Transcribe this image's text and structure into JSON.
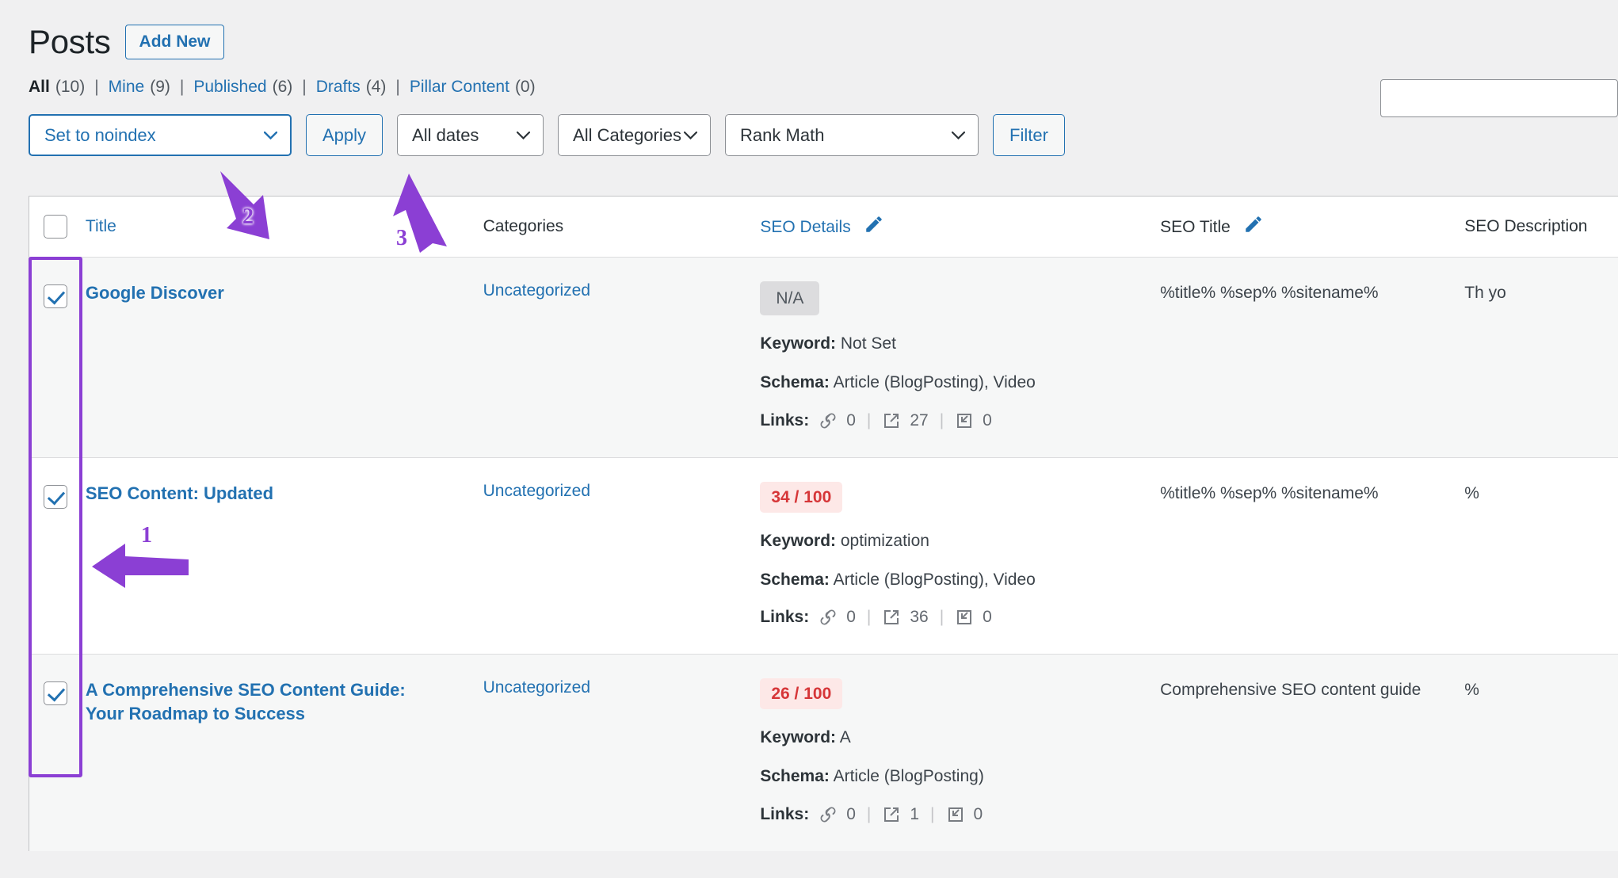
{
  "header": {
    "title": "Posts",
    "add_new_label": "Add New"
  },
  "search": {
    "value": "",
    "placeholder": ""
  },
  "status_filters": [
    {
      "label": "All",
      "count": "(10)",
      "current": true
    },
    {
      "label": "Mine",
      "count": "(9)",
      "current": false
    },
    {
      "label": "Published",
      "count": "(6)",
      "current": false
    },
    {
      "label": "Drafts",
      "count": "(4)",
      "current": false
    },
    {
      "label": "Pillar Content",
      "count": "(0)",
      "current": false
    }
  ],
  "tablenav": {
    "bulk_action": "Set to noindex",
    "apply_label": "Apply",
    "dates_filter": "All dates",
    "categories_filter": "All Categories",
    "rankmath_filter": "Rank Math",
    "filter_label": "Filter"
  },
  "table": {
    "columns": {
      "title": "Title",
      "categories": "Categories",
      "seo_details": "SEO Details",
      "seo_title": "SEO Title",
      "seo_desc": "SEO Description"
    },
    "rows": [
      {
        "checked": true,
        "title": "Google Discover",
        "category": "Uncategorized",
        "score": "N/A",
        "score_type": "na",
        "keyword_label": "Keyword:",
        "keyword": "Not Set",
        "schema_label": "Schema:",
        "schema": "Article (BlogPosting), Video",
        "links_label": "Links:",
        "links_internal": "0",
        "links_external": "27",
        "links_incoming": "0",
        "seo_title": "%title% %sep% %sitename%",
        "seo_desc": "Th\nyo"
      },
      {
        "checked": true,
        "title": "SEO Content: Updated",
        "category": "Uncategorized",
        "score": "34 / 100",
        "score_type": "bad",
        "keyword_label": "Keyword:",
        "keyword": "optimization",
        "schema_label": "Schema:",
        "schema": "Article (BlogPosting), Video",
        "links_label": "Links:",
        "links_internal": "0",
        "links_external": "36",
        "links_incoming": "0",
        "seo_title": "%title% %sep% %sitename%",
        "seo_desc": "%"
      },
      {
        "checked": true,
        "title": "A Comprehensive SEO Content Guide: Your Roadmap to Success",
        "category": "Uncategorized",
        "score": "26 / 100",
        "score_type": "bad",
        "keyword_label": "Keyword:",
        "keyword": "A",
        "schema_label": "Schema:",
        "schema": "Article (BlogPosting)",
        "links_label": "Links:",
        "links_internal": "0",
        "links_external": "1",
        "links_incoming": "0",
        "seo_title": "Comprehensive SEO content guide",
        "seo_desc": "%"
      }
    ]
  },
  "annotations": [
    {
      "num": "1"
    },
    {
      "num": "2"
    },
    {
      "num": "3"
    }
  ],
  "colors": {
    "accent": "#2271b1",
    "annotation": "#8b3fd4",
    "score_bad": "#d63638",
    "score_bad_bg": "#fde8e7"
  }
}
